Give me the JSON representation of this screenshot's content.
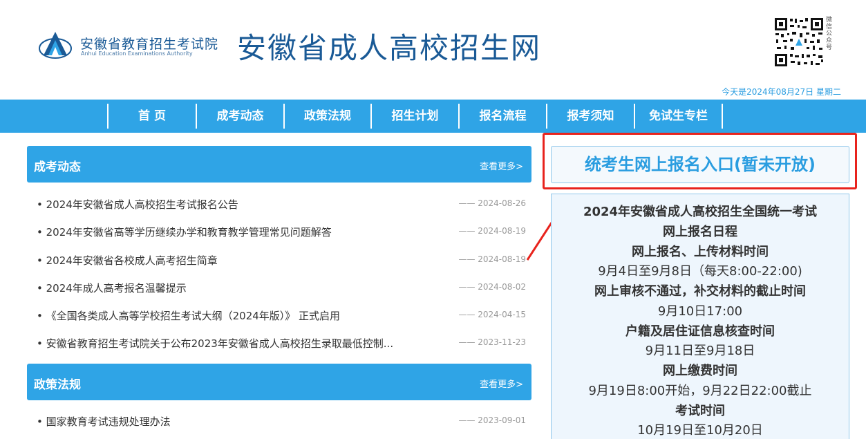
{
  "header": {
    "org_name_cn": "安徽省教育招生考试院",
    "org_name_en": "Anhui Education Examinations Authority",
    "site_title": "安徽省成人高校招生网",
    "qr_caption": "微信公众号",
    "date_text": "今天是2024年08月27日 星期二"
  },
  "nav": {
    "items": [
      "首 页",
      "成考动态",
      "政策法规",
      "招生计划",
      "报名流程",
      "报考须知",
      "免试生专栏"
    ]
  },
  "sections": [
    {
      "title": "成考动态",
      "more": "查看更多>",
      "items": [
        {
          "title": "• 2024年安徽省成人高校招生考试报名公告",
          "date": "—— 2024-08-26"
        },
        {
          "title": "• 2024年安徽省高等学历继续办学和教育教学管理常见问题解答",
          "date": "—— 2024-08-19"
        },
        {
          "title": "• 2024年安徽省各校成人高考招生简章",
          "date": "—— 2024-08-19"
        },
        {
          "title": "• 2024年成人高考报名温馨提示",
          "date": "—— 2024-08-02"
        },
        {
          "title": "• 《全国各类成人高等学校招生考试大纲（2024年版）》 正式启用",
          "date": "—— 2024-04-15"
        },
        {
          "title": "• 安徽省教育招生考试院关于公布2023年安徽省成人高校招生录取最低控制...",
          "date": "—— 2023-11-23"
        }
      ]
    },
    {
      "title": "政策法规",
      "more": "查看更多>",
      "items": [
        {
          "title": "• 国家教育考试违规处理办法",
          "date": "—— 2023-09-01"
        }
      ]
    }
  ],
  "right": {
    "enroll_button": "统考生网上报名入口(暂未开放)",
    "schedule_lines": [
      {
        "text": "2024年安徽省成人高校招生全国统一考试",
        "bold": true
      },
      {
        "text": "网上报名日程",
        "bold": true
      },
      {
        "text": "网上报名、上传材料时间",
        "bold": true
      },
      {
        "text": "9月4日至9月8日（每天8:00-22:00)",
        "bold": false
      },
      {
        "text": "网上审核不通过，补交材料的截止时间",
        "bold": true
      },
      {
        "text": "9月10日17:00",
        "bold": false
      },
      {
        "text": "户籍及居住证信息核查时间",
        "bold": true
      },
      {
        "text": "9月11日至9月18日",
        "bold": false
      },
      {
        "text": "网上缴费时间",
        "bold": true
      },
      {
        "text": "9月19日8:00开始，9月22日22:00截止",
        "bold": false
      },
      {
        "text": "考试时间",
        "bold": true
      },
      {
        "text": "10月19日至10月20日",
        "bold": false
      }
    ]
  },
  "colors": {
    "nav_bg": "#2fa4e6",
    "brand_text": "#1a5a96",
    "highlight_red": "#e8231d"
  }
}
